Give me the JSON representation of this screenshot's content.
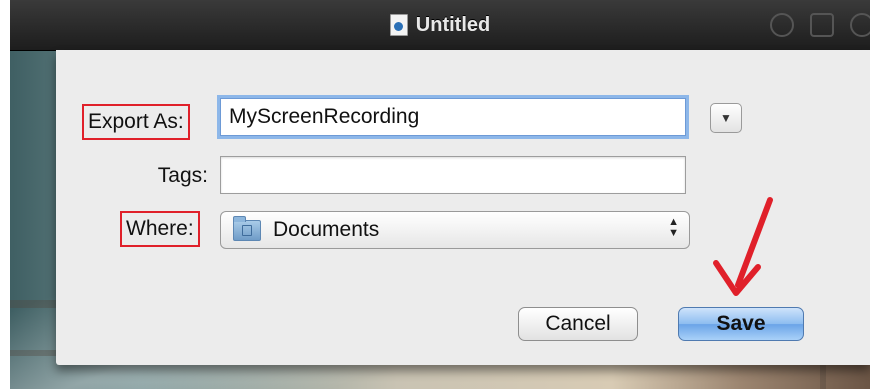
{
  "window": {
    "title": "Untitled"
  },
  "form": {
    "export_as_label": "Export As:",
    "export_as_value": "MyScreenRecording",
    "tags_label": "Tags:",
    "tags_value": "",
    "where_label": "Where:",
    "where_value": "Documents"
  },
  "buttons": {
    "cancel": "Cancel",
    "save": "Save"
  },
  "icons": {
    "title": "document-icon",
    "disclosure": "chevron-down-icon",
    "location": "folder-icon",
    "stepper": "stepper-icon",
    "annotation": "red-arrow-icon"
  },
  "colors": {
    "annotation": "#e0202a",
    "focus_ring": "#6da5e8",
    "default_button": "#8dbdf0"
  }
}
